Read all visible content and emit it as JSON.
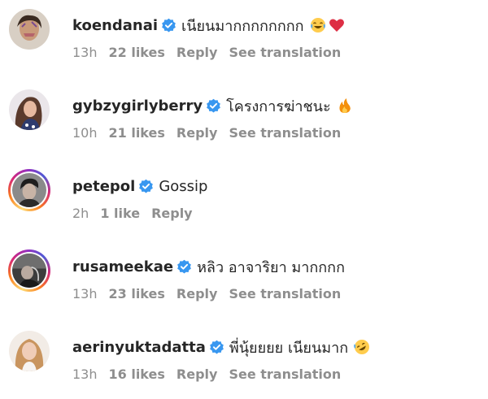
{
  "colors": {
    "verified": "#3897f0",
    "meta_text": "#8e8e8e",
    "body_text": "#262626",
    "story_ring": [
      "#feda75",
      "#fa7e1e",
      "#d62976",
      "#962fbf"
    ]
  },
  "comments": [
    {
      "username": "koendanai",
      "text": "เนียนมากกกกกกกก",
      "emoji": [
        "joy-emoji",
        "red-heart-emoji"
      ],
      "time": "13h",
      "likes": "22 likes",
      "reply": "Reply",
      "translation": "See translation"
    },
    {
      "username": "gybzygirlyberry",
      "text": "โครงการฆ่าชนะ",
      "emoji": [
        "fire-emoji"
      ],
      "time": "10h",
      "likes": "21 likes",
      "reply": "Reply",
      "translation": "See translation"
    },
    {
      "username": "petepol",
      "text": "Gossip",
      "emoji": [],
      "time": "2h",
      "likes": "1 like",
      "reply": "Reply",
      "translation": ""
    },
    {
      "username": "rusameekae",
      "text": "หลิว อาจาริยา มากกกก",
      "emoji": [],
      "time": "13h",
      "likes": "23 likes",
      "reply": "Reply",
      "translation": "See translation"
    },
    {
      "username": "aerinyuktadatta",
      "text": "พี่นุ้ยยยย เนียนมาก",
      "emoji": [
        "rofl-emoji"
      ],
      "time": "13h",
      "likes": "16 likes",
      "reply": "Reply",
      "translation": "See translation"
    }
  ]
}
